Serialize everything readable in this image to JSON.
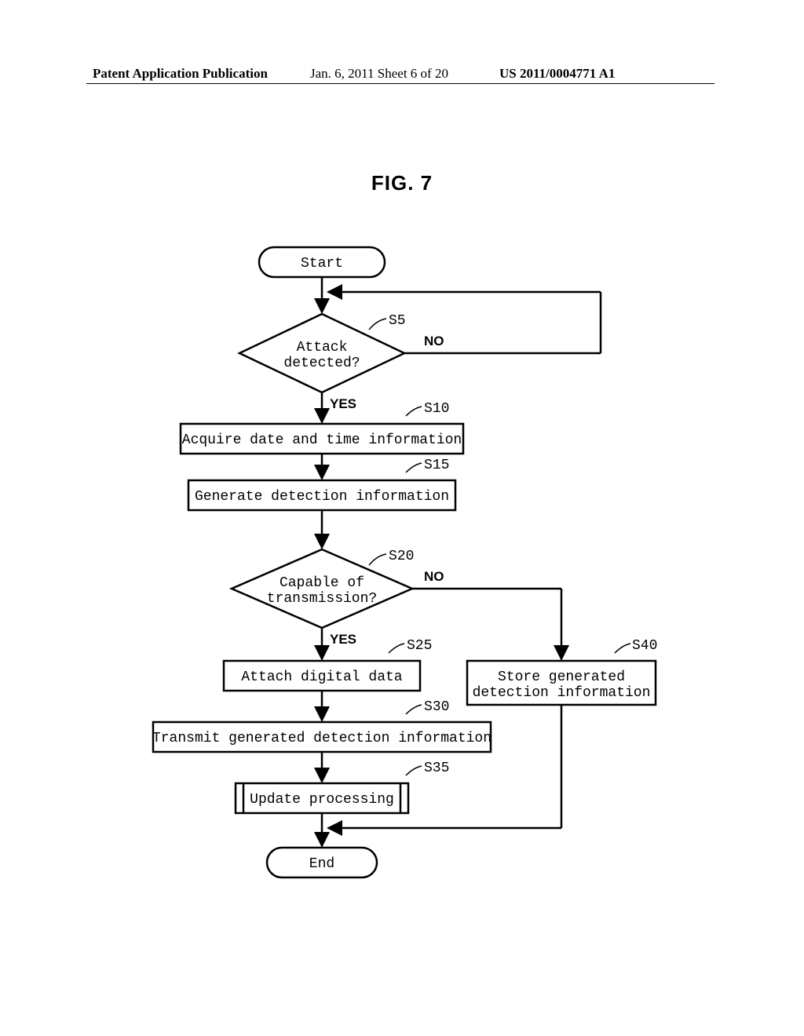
{
  "header": {
    "left": "Patent Application Publication",
    "mid": "Jan. 6, 2011  Sheet 6 of 20",
    "right": "US 2011/0004771 A1"
  },
  "figure_title": "FIG. 7",
  "flowchart": {
    "start": "Start",
    "end": "End",
    "d1": {
      "line1": "Attack",
      "line2": "detected?",
      "label": "S5",
      "yes": "YES",
      "no": "NO"
    },
    "s10": {
      "text": "Acquire date and time information",
      "label": "S10"
    },
    "s15": {
      "text": "Generate detection information",
      "label": "S15"
    },
    "d2": {
      "line1": "Capable of",
      "line2": "transmission?",
      "label": "S20",
      "yes": "YES",
      "no": "NO"
    },
    "s25": {
      "text": "Attach digital data",
      "label": "S25"
    },
    "s30": {
      "text": "Transmit generated detection information",
      "label": "S30"
    },
    "s35": {
      "text": "Update processing",
      "label": "S35"
    },
    "s40": {
      "line1": "Store generated",
      "line2": "detection information",
      "label": "S40"
    }
  }
}
